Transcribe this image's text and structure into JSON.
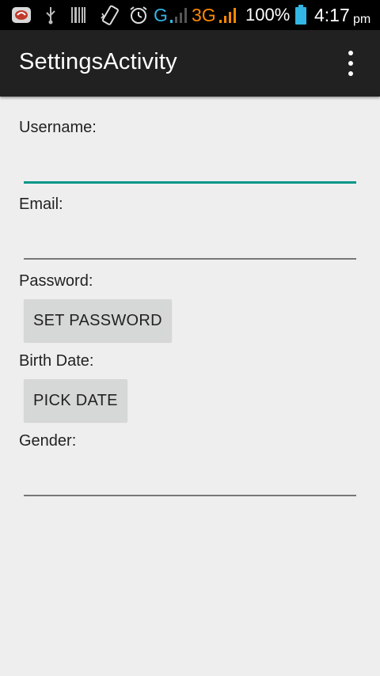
{
  "status_bar": {
    "network_type_1": "G",
    "network_type_2": "3G",
    "battery": "100%",
    "time": "4:17",
    "ampm": "pm",
    "icons": [
      "app-notification-icon",
      "usb-icon",
      "barcode-icon",
      "vibrate-icon",
      "alarm-icon",
      "signal-icon",
      "signal-icon",
      "battery-icon"
    ],
    "colors": {
      "g_signal": "#33b5e5",
      "threeg_signal": "#ff8800",
      "battery": "#33b5e5"
    }
  },
  "app_bar": {
    "title": "SettingsActivity",
    "overflow_icon": "more-vert-icon"
  },
  "form": {
    "username_label": "Username:",
    "username_value": "",
    "email_label": "Email:",
    "email_value": "",
    "password_label": "Password:",
    "set_password_button": "SET PASSWORD",
    "birthdate_label": "Birth Date:",
    "pick_date_button": "PICK DATE",
    "gender_label": "Gender:",
    "gender_value": ""
  },
  "colors": {
    "background": "#eeeeee",
    "app_bar": "#212121",
    "accent": "#009688",
    "button": "#d6d7d7"
  }
}
